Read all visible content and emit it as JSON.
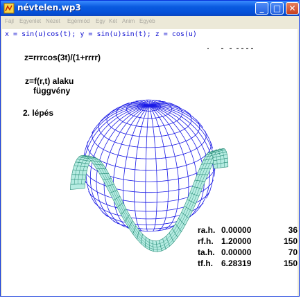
{
  "window": {
    "title": "névtelen.wp3",
    "minimize_glyph": "_",
    "maximize_glyph": "□",
    "close_glyph": "✕"
  },
  "menu": {
    "items": [
      "Fájl",
      "Egyenlet",
      "Nézet",
      "Egérmód",
      "Egy",
      "Két",
      "Anim",
      "Egyéb"
    ]
  },
  "content": {
    "equation": "x = sin(u)cos(t); y = sin(u)sin(t); z = cos(u)",
    "formula": "z=rrrcos(3t)/(1+rrrr)",
    "form_line1": "z=f(r,t) alaku",
    "form_line2": "függvény",
    "step": "2. lépés"
  },
  "params": [
    {
      "name": "ra.h.",
      "value": "0.00000",
      "count": "36"
    },
    {
      "name": "rf.h.",
      "value": "1.20000",
      "count": "150"
    },
    {
      "name": "ta.h.",
      "value": "0.00000",
      "count": "70"
    },
    {
      "name": "tf.h.",
      "value": "6.28319",
      "count": "150"
    }
  ],
  "colors": {
    "sphere_mesh": "#1a1ae6",
    "surface_mesh": "#2a8f7a",
    "surface_fill": "#b6ece2",
    "equation_text": "#1010d0"
  },
  "icons": {
    "app": "app-icon"
  }
}
